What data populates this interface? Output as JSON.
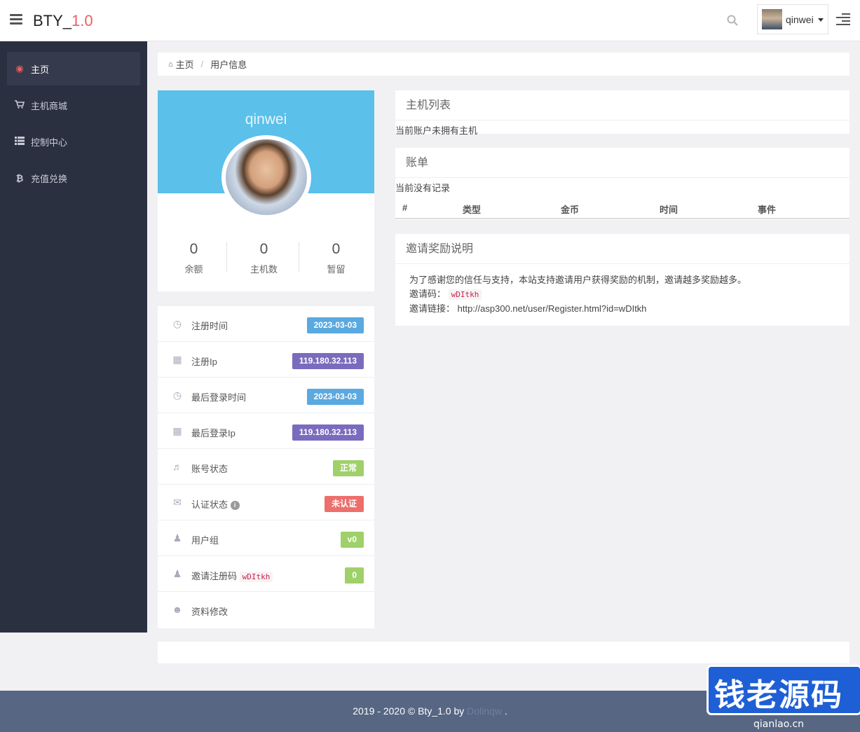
{
  "app": {
    "name": "BTY_",
    "version": "1.0"
  },
  "topbar": {
    "username": "qinwei"
  },
  "sidebar": {
    "items": [
      {
        "label": "主页",
        "icon": "dashboard-icon",
        "active": true
      },
      {
        "label": "主机商城",
        "icon": "cart-icon"
      },
      {
        "label": "控制中心",
        "icon": "grid-icon"
      },
      {
        "label": "充值兑换",
        "icon": "bitcoin-icon"
      }
    ]
  },
  "breadcrumb": {
    "home": "主页",
    "current": "用户信息"
  },
  "profile": {
    "name": "qinwei",
    "stats": [
      {
        "value": "0",
        "label": "余额"
      },
      {
        "value": "0",
        "label": "主机数"
      },
      {
        "value": "0",
        "label": "暂留"
      }
    ]
  },
  "info": [
    {
      "label": "注册时间",
      "value": "2023-03-03",
      "icon": "clock-icon",
      "color": "#5aa9e0"
    },
    {
      "label": "注册Ip",
      "value": "119.180.32.113",
      "icon": "calendar-icon",
      "color": "#7b6bbe"
    },
    {
      "label": "最后登录时间",
      "value": "2023-03-03",
      "icon": "clock-icon",
      "color": "#5aa9e0"
    },
    {
      "label": "最后登录Ip",
      "value": "119.180.32.113",
      "icon": "calendar-icon",
      "color": "#7b6bbe"
    },
    {
      "label": "账号状态",
      "value": "正常",
      "icon": "bell-icon",
      "color": "#9fd06a"
    },
    {
      "label": "认证状态",
      "value": "未认证",
      "icon": "envelope-icon",
      "color": "#ec6f6b"
    },
    {
      "label": "用户组",
      "value": "v0",
      "icon": "users-icon",
      "color": "#9fd06a"
    },
    {
      "label": "邀请注册码",
      "code": "wDItkh",
      "value": "0",
      "icon": "users-icon",
      "color": "#9fd06a"
    },
    {
      "label": "资料修改",
      "icon": "user-icon"
    }
  ],
  "hosts_panel": {
    "title": "主机列表",
    "message": "当前账户未拥有主机"
  },
  "bill_panel": {
    "title": "账单",
    "message": "当前没有记录",
    "columns": [
      "#",
      "类型",
      "金币",
      "时间",
      "事件"
    ]
  },
  "invite_panel": {
    "title": "邀请奖励说明",
    "description": "为了感谢您的信任与支持，本站支持邀请用户获得奖励的机制，邀请越多奖励越多。",
    "code_label": "邀请码：",
    "code": "wDItkh",
    "link_label": "邀请链接：",
    "link": "http://asp300.net/user/Register.html?id=wDItkh"
  },
  "footer": {
    "text": "2019 - 2020 © Bty_1.0 by",
    "author": "Dolinqw",
    "suffix": " ."
  },
  "watermark": {
    "text": "钱老源码",
    "url": "qianlao.cn"
  }
}
